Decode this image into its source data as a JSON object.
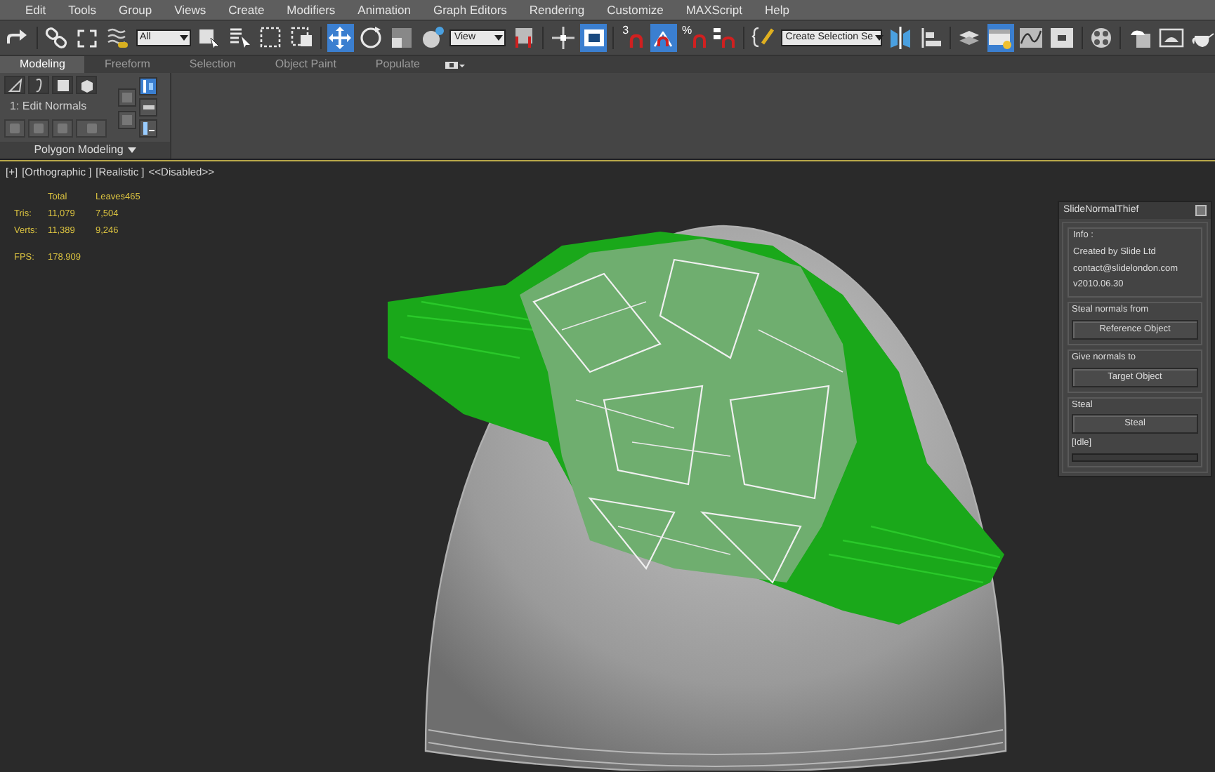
{
  "menu": [
    "Edit",
    "Tools",
    "Group",
    "Views",
    "Create",
    "Modifiers",
    "Animation",
    "Graph Editors",
    "Rendering",
    "Customize",
    "MAXScript",
    "Help"
  ],
  "toolbar": [
    {
      "kind": "icon",
      "selected": false
    },
    {
      "kind": "sep"
    },
    {
      "kind": "icon",
      "selected": false
    },
    {
      "kind": "icon",
      "selected": false
    },
    {
      "kind": "icon",
      "selected": false
    },
    {
      "kind": "dropdown",
      "value": "All"
    },
    {
      "kind": "icon",
      "selected": false
    },
    {
      "kind": "icon",
      "selected": false
    },
    {
      "kind": "icon",
      "selected": false
    },
    {
      "kind": "icon",
      "selected": false
    },
    {
      "kind": "sep"
    },
    {
      "kind": "icon",
      "selected": true
    },
    {
      "kind": "icon",
      "selected": false
    },
    {
      "kind": "icon",
      "selected": false
    },
    {
      "kind": "icon",
      "selected": false
    },
    {
      "kind": "dropdown",
      "value": "View"
    },
    {
      "kind": "icon",
      "selected": false
    },
    {
      "kind": "sep"
    },
    {
      "kind": "icon",
      "selected": false
    },
    {
      "kind": "icon",
      "selected": true
    },
    {
      "kind": "sep"
    },
    {
      "kind": "icon",
      "selected": false,
      "label": "3"
    },
    {
      "kind": "icon",
      "selected": true
    },
    {
      "kind": "icon",
      "selected": false,
      "label": "%"
    },
    {
      "kind": "icon",
      "selected": false
    },
    {
      "kind": "sep"
    },
    {
      "kind": "icon",
      "selected": false
    },
    {
      "kind": "dropdown",
      "value": "Create Selection Se"
    },
    {
      "kind": "icon",
      "selected": false
    },
    {
      "kind": "icon",
      "selected": false
    },
    {
      "kind": "sep"
    },
    {
      "kind": "icon",
      "selected": false
    },
    {
      "kind": "icon",
      "selected": true
    },
    {
      "kind": "icon",
      "selected": false
    },
    {
      "kind": "icon",
      "selected": false
    },
    {
      "kind": "sep"
    },
    {
      "kind": "icon",
      "selected": false
    },
    {
      "kind": "sep"
    },
    {
      "kind": "icon",
      "selected": false
    },
    {
      "kind": "icon",
      "selected": false
    },
    {
      "kind": "icon",
      "selected": false
    }
  ],
  "ribbon_tabs": [
    {
      "label": "Modeling",
      "selected": true
    },
    {
      "label": "Freeform",
      "selected": false
    },
    {
      "label": "Selection",
      "selected": false
    },
    {
      "label": "Object Paint",
      "selected": false
    },
    {
      "label": "Populate",
      "selected": false
    }
  ],
  "ribbon_panel": {
    "mode_label": "1: Edit Normals",
    "footer": "Polygon Modeling"
  },
  "viewport": {
    "labels": [
      "[+]",
      "[Orthographic ]",
      "[Realistic ]",
      "<<Disabled>>"
    ],
    "stats": {
      "columns": [
        "Total",
        "Leaves465"
      ],
      "rows": [
        {
          "label": "Tris:",
          "values": [
            "11,079",
            "7,504"
          ]
        },
        {
          "label": "Verts:",
          "values": [
            "11,389",
            "9,246"
          ]
        }
      ],
      "fps_label": "FPS:",
      "fps": "178.909"
    }
  },
  "dialog": {
    "title": "SlideNormalThief",
    "info_group": "Info :",
    "info_lines": [
      "Created by Slide Ltd",
      "contact@slidelondon.com",
      "v2010.06.30"
    ],
    "groups": [
      {
        "label": "Steal normals from",
        "button": "Reference Object"
      },
      {
        "label": "Give normals to",
        "button": "Target Object"
      },
      {
        "label": "Steal",
        "button": "Steal"
      }
    ],
    "status": "[Idle]",
    "progress": {
      "level": 0
    }
  }
}
